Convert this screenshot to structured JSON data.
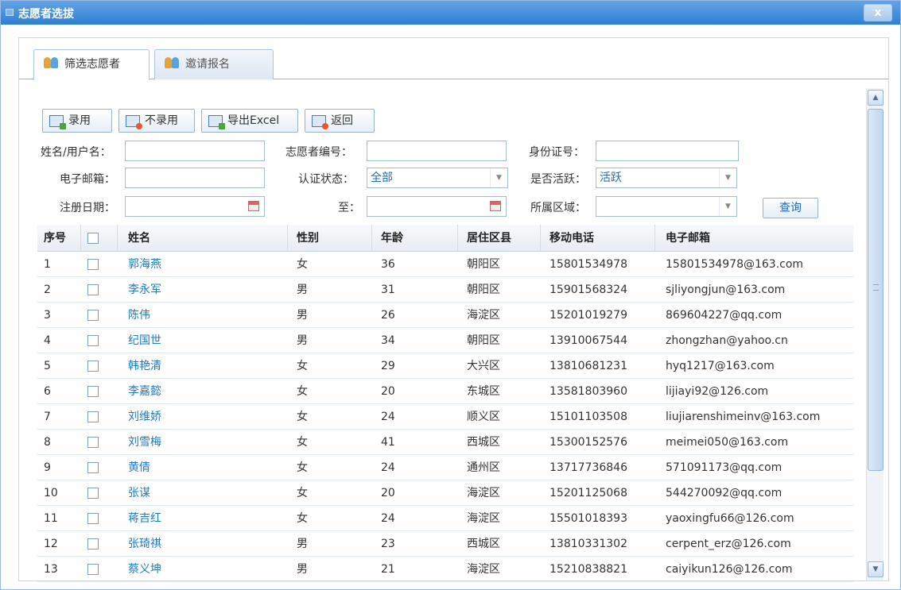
{
  "window": {
    "title": "志愿者选拔",
    "close_label": "x"
  },
  "tabs": [
    {
      "label": "筛选志愿者",
      "active": true
    },
    {
      "label": "邀请报名",
      "active": false
    }
  ],
  "toolbar": {
    "buttons": [
      {
        "label": "录用",
        "icon": "accept-icon"
      },
      {
        "label": "不录用",
        "icon": "reject-icon"
      },
      {
        "label": "导出Excel",
        "icon": "export-excel-icon"
      },
      {
        "label": "返回",
        "icon": "return-icon"
      }
    ]
  },
  "filters": {
    "name_label": "姓名/用户名：",
    "name_value": "",
    "volunteer_id_label": "志愿者编号：",
    "volunteer_id_value": "",
    "id_card_label": "身份证号：",
    "id_card_value": "",
    "email_label": "电子邮箱：",
    "email_value": "",
    "auth_status_label": "认证状态：",
    "auth_status_value": "全部",
    "active_label": "是否活跃：",
    "active_value": "活跃",
    "reg_date_label": "注册日期：",
    "reg_date_from": "",
    "to_label": "至：",
    "reg_date_to": "",
    "region_label": "所属区域：",
    "region_value": "",
    "search_label": "查询"
  },
  "grid": {
    "columns": [
      "序号",
      "",
      "姓名",
      "性别",
      "年龄",
      "居住区县",
      "移动电话",
      "电子邮箱"
    ],
    "rows": [
      [
        "1",
        "郭海燕",
        "女",
        "36",
        "朝阳区",
        "15801534978",
        "15801534978@163.com"
      ],
      [
        "2",
        "李永军",
        "男",
        "31",
        "朝阳区",
        "15901568324",
        "sjliyongjun@163.com"
      ],
      [
        "3",
        "陈伟",
        "男",
        "26",
        "海淀区",
        "15201019279",
        "869604227@qq.com"
      ],
      [
        "4",
        "纪国世",
        "男",
        "34",
        "朝阳区",
        "13910067544",
        "zhongzhan@yahoo.cn"
      ],
      [
        "5",
        "韩艳清",
        "女",
        "29",
        "大兴区",
        "13810681231",
        "hyq1217@163.com"
      ],
      [
        "6",
        "李嘉懿",
        "女",
        "20",
        "东城区",
        "13581803960",
        "lijiayi92@126.com"
      ],
      [
        "7",
        "刘维娇",
        "女",
        "24",
        "顺义区",
        "15101103508",
        "liujiarenshimeinv@163.com"
      ],
      [
        "8",
        "刘雪梅",
        "女",
        "41",
        "西城区",
        "15300152576",
        "meimei050@163.com"
      ],
      [
        "9",
        "黄倩",
        "女",
        "24",
        "通州区",
        "13717736846",
        "571091173@qq.com"
      ],
      [
        "10",
        "张谋",
        "女",
        "20",
        "海淀区",
        "15201125068",
        "544270092@qq.com"
      ],
      [
        "11",
        "蒋吉红",
        "女",
        "24",
        "海淀区",
        "15501018393",
        "yaoxingfu66@126.com"
      ],
      [
        "12",
        "张琦祺",
        "男",
        "23",
        "西城区",
        "13810331302",
        "cerpent_erz@126.com"
      ],
      [
        "13",
        "蔡义坤",
        "男",
        "21",
        "海淀区",
        "15210838821",
        "caiyikun126@126.com"
      ]
    ]
  }
}
